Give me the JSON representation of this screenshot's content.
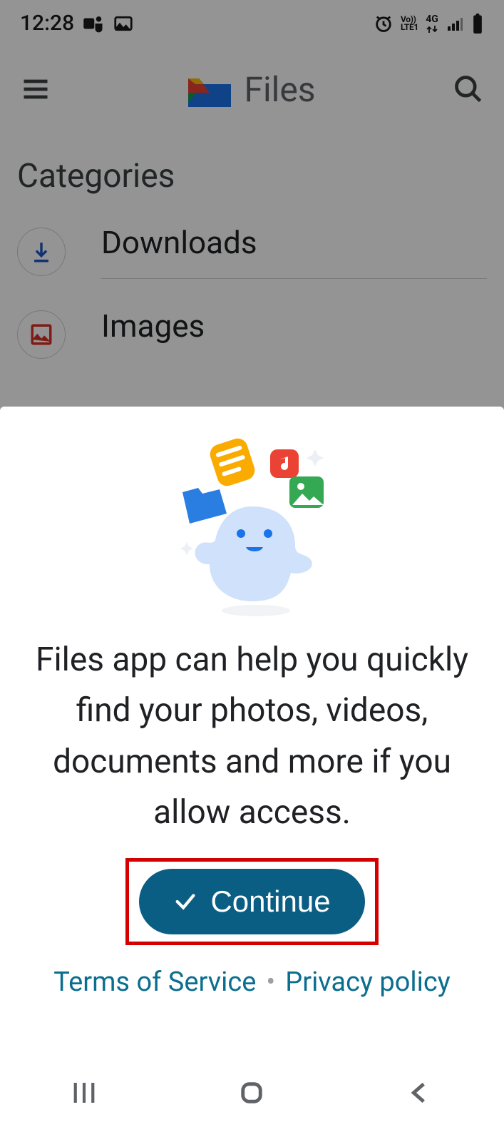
{
  "status": {
    "time": "12:28",
    "network_label_top": "Vo))",
    "network_label_bottom": "LTE1",
    "data_label": "4G"
  },
  "app_bar": {
    "title": "Files"
  },
  "section_title": "Categories",
  "categories": [
    {
      "label": "Downloads"
    },
    {
      "label": "Images"
    }
  ],
  "sheet": {
    "message": "Files app can help you quickly find your photos, videos, documents and more if you allow access.",
    "continue_label": "Continue",
    "tos_label": "Terms of Service",
    "privacy_label": "Privacy policy"
  }
}
